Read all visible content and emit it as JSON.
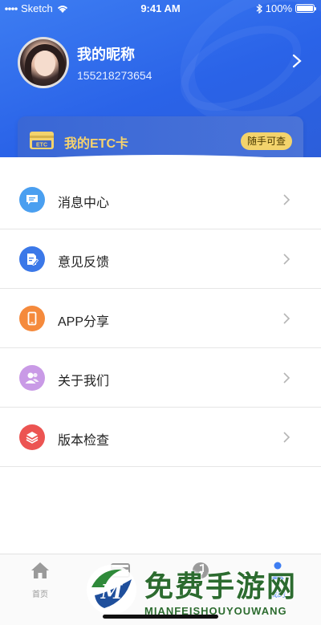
{
  "status_bar": {
    "carrier": "Sketch",
    "time": "9:41 AM",
    "battery": "100%"
  },
  "profile": {
    "nickname": "我的昵称",
    "phone": "155218273654"
  },
  "etc_card": {
    "icon_text": "ETC",
    "label": "我的ETC卡",
    "button": "随手可查"
  },
  "menu": [
    {
      "label": "消息中心",
      "icon": "message-icon",
      "color": "#4a9ff0"
    },
    {
      "label": "意见反馈",
      "icon": "feedback-icon",
      "color": "#3b78e8"
    },
    {
      "label": "APP分享",
      "icon": "phone-share-icon",
      "color": "#f58a3c"
    },
    {
      "label": "关于我们",
      "icon": "users-icon",
      "color": "#c99ae6"
    },
    {
      "label": "版本检查",
      "icon": "layers-icon",
      "color": "#ec5452"
    }
  ],
  "tabbar": {
    "tabs": [
      {
        "label": "首页",
        "icon": "home-icon"
      },
      {
        "label": "",
        "icon": "card-icon"
      },
      {
        "label": "",
        "icon": "music-icon"
      },
      {
        "label": "我的",
        "icon": "profile-icon"
      }
    ]
  },
  "watermark": {
    "logo_letter": "M",
    "title": "免费手游网",
    "subtitle": "MIANFEISHOUYOUWANG"
  },
  "colors": {
    "header": "#3d7df2",
    "etc_gold": "#f3d36c"
  }
}
